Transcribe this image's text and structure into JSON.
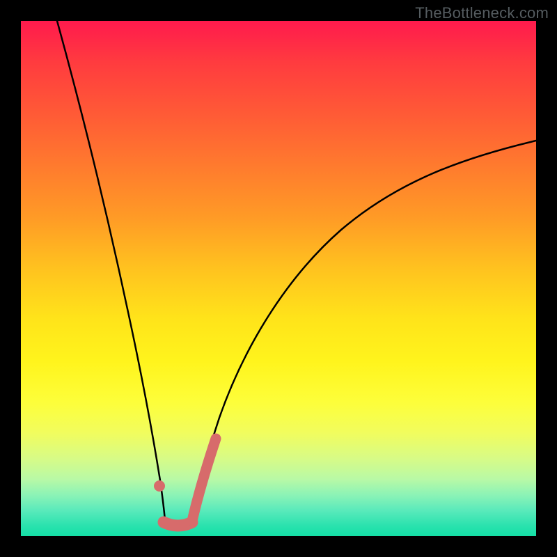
{
  "watermark": "TheBottleneck.com",
  "chart_data": {
    "type": "line",
    "title": "",
    "xlabel": "",
    "ylabel": "",
    "x_range_percent": [
      0,
      100
    ],
    "y_range_percent": [
      0,
      100
    ],
    "description": "V-shaped bottleneck curve over a vertical red-to-green gradient; minimum near the lower-left third.",
    "minimum_x_percent": 30,
    "series": [
      {
        "name": "left-branch",
        "x_percent": [
          7,
          10,
          13,
          16,
          19,
          22,
          24.5,
          26.3,
          27.5
        ],
        "y_percent": [
          100,
          88,
          75,
          61,
          46,
          30,
          16,
          7,
          3
        ]
      },
      {
        "name": "right-branch",
        "x_percent": [
          33,
          34.5,
          37,
          41,
          47,
          55,
          63,
          72,
          82,
          92,
          100
        ],
        "y_percent": [
          3,
          8,
          17,
          30,
          43,
          54,
          61,
          67,
          71.5,
          75,
          77
        ]
      }
    ],
    "highlight_segments": [
      {
        "name": "left-pink-dot",
        "x_percent": 26.3,
        "y_percent": 7,
        "radius_px": 7
      },
      {
        "name": "valley-pink-band",
        "x0_percent": 27.5,
        "x1_percent": 33,
        "y_percent": 3,
        "thickness_px": 14
      },
      {
        "name": "right-pink-stroke",
        "x0_percent": 33,
        "x1_percent": 37.5,
        "thickness_px": 14
      }
    ],
    "gradient_stops": [
      {
        "pos": 0.0,
        "color": "#ff1a4d"
      },
      {
        "pos": 0.5,
        "color": "#ffd21a"
      },
      {
        "pos": 0.8,
        "color": "#f1fd5e"
      },
      {
        "pos": 1.0,
        "color": "#14dfa6"
      }
    ]
  }
}
